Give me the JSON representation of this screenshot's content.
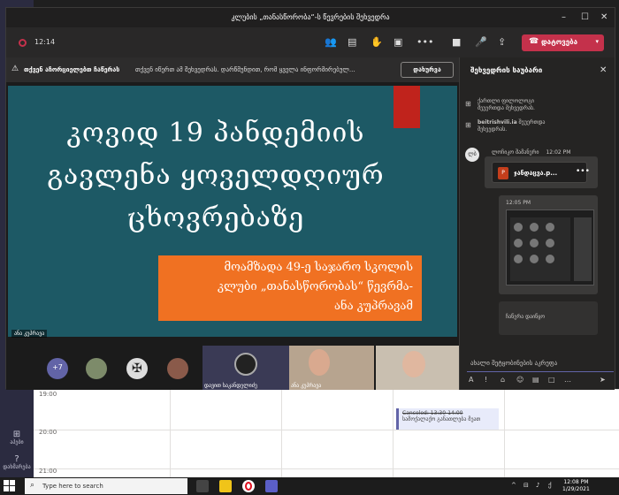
{
  "window": {
    "title": "კლუბის „თანასწორობა“-ს წევრების შეხვედრა",
    "minimize": "–",
    "maximize": "☐",
    "close": "✕"
  },
  "toolbar": {
    "timer": "12:14",
    "leave_label": "დატოვება",
    "more": "•••"
  },
  "banner": {
    "title": "თქვენ აჩორციელებთ ჩაწერას",
    "text": "თქვენ იწერთ ამ შეხვედრას. დარწმუნდით, რომ ყველა ინფორმირებულ...",
    "dismiss_label": "დახურვა"
  },
  "slide": {
    "line1": "კოვიდ 19 პანდემიის",
    "line2": "გავლენა ყოველდღიურ",
    "line3": "ცხოვრებაზე",
    "sub1": "მოამზადა 49-ე საჯარო სკოლის",
    "sub2": "კლუბი „თანასწორობას“ წევრმა-",
    "sub3": "ანა კუპრავამ",
    "presenter": "ანა კუპრავა"
  },
  "participants": {
    "more_count": "+7",
    "tile1_label": "დავით საკანდელიძე",
    "tile2_label": "ანა კუპრავა"
  },
  "chat": {
    "title": "შეხვედრის საუბარი",
    "sys1_line1": "ქართლი ფილოლოგი",
    "sys1_line2": "შეუერთდა შეხვედრას.",
    "sys2_name": "beitrishvili.ia",
    "sys2_line1": "შეუერთდა",
    "sys2_line2": "შეხვედრას.",
    "msg_avatar": "ლბ",
    "msg_author": "ლოჩიკო შამანური",
    "msg_time": "12:02 PM",
    "file_name": "ჯანდაცვა.p...",
    "file_more": "•••",
    "ppt_letter": "P",
    "shot_time": "12:05 PM",
    "reply_text": "ჩაწერა დაიწყო",
    "compose_placeholder": "ახალი შეტყობინების აკრეფა"
  },
  "calendar": {
    "h1": "19:00",
    "h2": "20:00",
    "h3": "21:00",
    "event_line1": "Canceled: 13:30-14:00",
    "event_line2": "სამოქალაქო განათლება მეათ"
  },
  "sidebar": {
    "apps_label": "აპები",
    "help_label": "დახმარება"
  },
  "taskbar": {
    "search_placeholder": "Type here to search",
    "time": "12:08 PM",
    "date": "1/29/2021"
  }
}
